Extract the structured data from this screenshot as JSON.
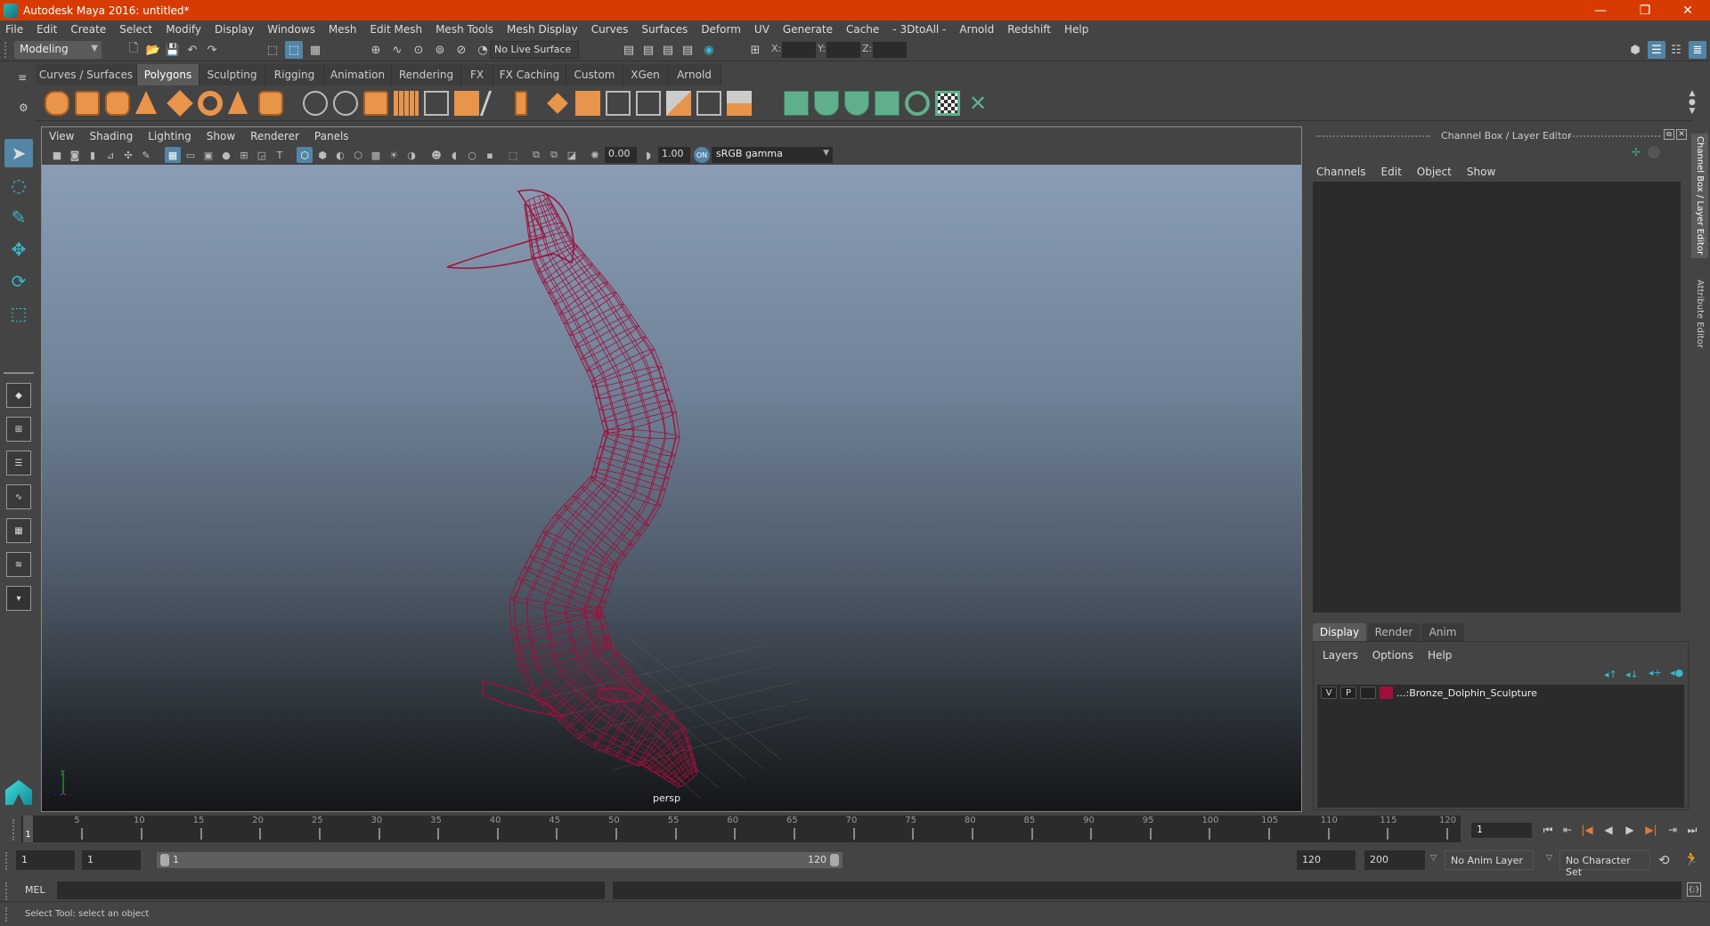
{
  "window": {
    "title": "Autodesk Maya 2016: untitled*",
    "controls": {
      "minimize": "—",
      "restore": "❐",
      "close": "✕"
    }
  },
  "menubar": [
    "File",
    "Edit",
    "Create",
    "Select",
    "Modify",
    "Display",
    "Windows",
    "Mesh",
    "Edit Mesh",
    "Mesh Tools",
    "Mesh Display",
    "Curves",
    "Surfaces",
    "Deform",
    "UV",
    "Generate",
    "Cache",
    "- 3DtoAll -",
    "Arnold",
    "Redshift",
    "Help"
  ],
  "statusline": {
    "mode": "Modeling",
    "live_surface": "No Live Surface",
    "x_label": "X:",
    "y_label": "Y:",
    "z_label": "Z:",
    "x_value": "",
    "y_value": "",
    "z_value": ""
  },
  "shelf": {
    "tabs": [
      "Curves / Surfaces",
      "Polygons",
      "Sculpting",
      "Rigging",
      "Animation",
      "Rendering",
      "FX",
      "FX Caching",
      "Custom",
      "XGen",
      "Arnold"
    ],
    "active_tab": "Polygons",
    "icons": [
      "poly-sphere",
      "poly-cube",
      "poly-cylinder",
      "poly-cone",
      "poly-plane",
      "poly-torus",
      "poly-pyramid",
      "poly-pipe",
      "combine",
      "separate",
      "mirror",
      "smooth",
      "extract",
      "booleans",
      "multi-cut",
      "bevel",
      "bridge",
      "extrude",
      "insert-edge-loop",
      "append-polygon",
      "fill-hole",
      "target-weld",
      "merge",
      "planar-uv",
      "cylindrical-uv",
      "spherical-uv",
      "automatic-uv",
      "unfold-uv",
      "uv-editor",
      "cut-uv"
    ]
  },
  "viewport": {
    "menu": [
      "View",
      "Shading",
      "Lighting",
      "Show",
      "Renderer",
      "Panels"
    ],
    "exposure": "0.00",
    "gamma": "1.00",
    "color_space": "sRGB gamma",
    "camera_label": "persp",
    "axis": {
      "x": "x",
      "y": "y",
      "z": "z"
    },
    "wireframe_color": "#a0103a"
  },
  "channel_box": {
    "title": "Channel Box / Layer Editor",
    "menu": [
      "Channels",
      "Edit",
      "Object",
      "Show"
    ]
  },
  "layer_editor": {
    "tabs": [
      "Display",
      "Render",
      "Anim"
    ],
    "active_tab": "Display",
    "menu": [
      "Layers",
      "Options",
      "Help"
    ],
    "layers": [
      {
        "visible": "V",
        "playback": "P",
        "color": "#a0103a",
        "name": "...:Bronze_Dolphin_Sculpture"
      }
    ]
  },
  "side_tabs": [
    "Channel Box / Layer Editor",
    "Attribute Editor"
  ],
  "timeline": {
    "start": 1,
    "end": 120,
    "current_frame": "1",
    "ticks": [
      "5",
      "10",
      "15",
      "20",
      "25",
      "30",
      "35",
      "40",
      "45",
      "50",
      "55",
      "60",
      "65",
      "70",
      "75",
      "80",
      "85",
      "90",
      "95",
      "100",
      "105",
      "110",
      "115",
      "120"
    ]
  },
  "range": {
    "anim_start": "1",
    "playback_start": "1",
    "range_start_label": "1",
    "range_end_label": "120",
    "playback_end": "120",
    "anim_end": "200",
    "anim_layer": "No Anim Layer",
    "character_set": "No Character Set"
  },
  "command_line": {
    "label": "MEL",
    "input": "",
    "output": ""
  },
  "help_line": "Select Tool: select an object"
}
